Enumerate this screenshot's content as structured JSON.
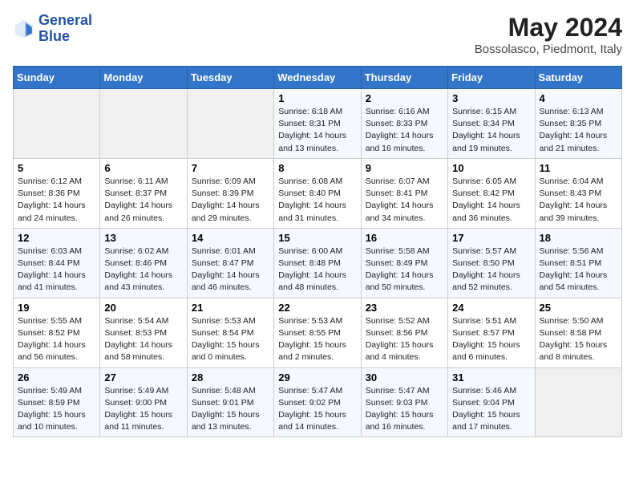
{
  "header": {
    "logo_line1": "General",
    "logo_line2": "Blue",
    "month_title": "May 2024",
    "location": "Bossolasco, Piedmont, Italy"
  },
  "days_of_week": [
    "Sunday",
    "Monday",
    "Tuesday",
    "Wednesday",
    "Thursday",
    "Friday",
    "Saturday"
  ],
  "weeks": [
    [
      {
        "day": "",
        "info": ""
      },
      {
        "day": "",
        "info": ""
      },
      {
        "day": "",
        "info": ""
      },
      {
        "day": "1",
        "info": "Sunrise: 6:18 AM\nSunset: 8:31 PM\nDaylight: 14 hours\nand 13 minutes."
      },
      {
        "day": "2",
        "info": "Sunrise: 6:16 AM\nSunset: 8:33 PM\nDaylight: 14 hours\nand 16 minutes."
      },
      {
        "day": "3",
        "info": "Sunrise: 6:15 AM\nSunset: 8:34 PM\nDaylight: 14 hours\nand 19 minutes."
      },
      {
        "day": "4",
        "info": "Sunrise: 6:13 AM\nSunset: 8:35 PM\nDaylight: 14 hours\nand 21 minutes."
      }
    ],
    [
      {
        "day": "5",
        "info": "Sunrise: 6:12 AM\nSunset: 8:36 PM\nDaylight: 14 hours\nand 24 minutes."
      },
      {
        "day": "6",
        "info": "Sunrise: 6:11 AM\nSunset: 8:37 PM\nDaylight: 14 hours\nand 26 minutes."
      },
      {
        "day": "7",
        "info": "Sunrise: 6:09 AM\nSunset: 8:39 PM\nDaylight: 14 hours\nand 29 minutes."
      },
      {
        "day": "8",
        "info": "Sunrise: 6:08 AM\nSunset: 8:40 PM\nDaylight: 14 hours\nand 31 minutes."
      },
      {
        "day": "9",
        "info": "Sunrise: 6:07 AM\nSunset: 8:41 PM\nDaylight: 14 hours\nand 34 minutes."
      },
      {
        "day": "10",
        "info": "Sunrise: 6:05 AM\nSunset: 8:42 PM\nDaylight: 14 hours\nand 36 minutes."
      },
      {
        "day": "11",
        "info": "Sunrise: 6:04 AM\nSunset: 8:43 PM\nDaylight: 14 hours\nand 39 minutes."
      }
    ],
    [
      {
        "day": "12",
        "info": "Sunrise: 6:03 AM\nSunset: 8:44 PM\nDaylight: 14 hours\nand 41 minutes."
      },
      {
        "day": "13",
        "info": "Sunrise: 6:02 AM\nSunset: 8:46 PM\nDaylight: 14 hours\nand 43 minutes."
      },
      {
        "day": "14",
        "info": "Sunrise: 6:01 AM\nSunset: 8:47 PM\nDaylight: 14 hours\nand 46 minutes."
      },
      {
        "day": "15",
        "info": "Sunrise: 6:00 AM\nSunset: 8:48 PM\nDaylight: 14 hours\nand 48 minutes."
      },
      {
        "day": "16",
        "info": "Sunrise: 5:58 AM\nSunset: 8:49 PM\nDaylight: 14 hours\nand 50 minutes."
      },
      {
        "day": "17",
        "info": "Sunrise: 5:57 AM\nSunset: 8:50 PM\nDaylight: 14 hours\nand 52 minutes."
      },
      {
        "day": "18",
        "info": "Sunrise: 5:56 AM\nSunset: 8:51 PM\nDaylight: 14 hours\nand 54 minutes."
      }
    ],
    [
      {
        "day": "19",
        "info": "Sunrise: 5:55 AM\nSunset: 8:52 PM\nDaylight: 14 hours\nand 56 minutes."
      },
      {
        "day": "20",
        "info": "Sunrise: 5:54 AM\nSunset: 8:53 PM\nDaylight: 14 hours\nand 58 minutes."
      },
      {
        "day": "21",
        "info": "Sunrise: 5:53 AM\nSunset: 8:54 PM\nDaylight: 15 hours\nand 0 minutes."
      },
      {
        "day": "22",
        "info": "Sunrise: 5:53 AM\nSunset: 8:55 PM\nDaylight: 15 hours\nand 2 minutes."
      },
      {
        "day": "23",
        "info": "Sunrise: 5:52 AM\nSunset: 8:56 PM\nDaylight: 15 hours\nand 4 minutes."
      },
      {
        "day": "24",
        "info": "Sunrise: 5:51 AM\nSunset: 8:57 PM\nDaylight: 15 hours\nand 6 minutes."
      },
      {
        "day": "25",
        "info": "Sunrise: 5:50 AM\nSunset: 8:58 PM\nDaylight: 15 hours\nand 8 minutes."
      }
    ],
    [
      {
        "day": "26",
        "info": "Sunrise: 5:49 AM\nSunset: 8:59 PM\nDaylight: 15 hours\nand 10 minutes."
      },
      {
        "day": "27",
        "info": "Sunrise: 5:49 AM\nSunset: 9:00 PM\nDaylight: 15 hours\nand 11 minutes."
      },
      {
        "day": "28",
        "info": "Sunrise: 5:48 AM\nSunset: 9:01 PM\nDaylight: 15 hours\nand 13 minutes."
      },
      {
        "day": "29",
        "info": "Sunrise: 5:47 AM\nSunset: 9:02 PM\nDaylight: 15 hours\nand 14 minutes."
      },
      {
        "day": "30",
        "info": "Sunrise: 5:47 AM\nSunset: 9:03 PM\nDaylight: 15 hours\nand 16 minutes."
      },
      {
        "day": "31",
        "info": "Sunrise: 5:46 AM\nSunset: 9:04 PM\nDaylight: 15 hours\nand 17 minutes."
      },
      {
        "day": "",
        "info": ""
      }
    ]
  ]
}
